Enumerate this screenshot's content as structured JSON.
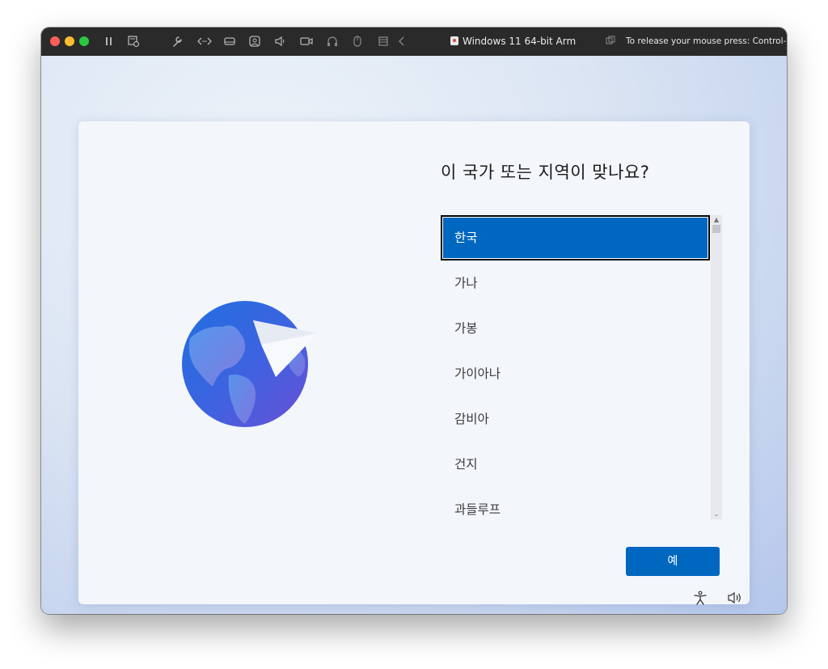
{
  "titlebar": {
    "title": "Windows 11 64-bit Arm",
    "release_hint": "To release your mouse press: Control-⌘",
    "icons": [
      "pause-icon",
      "snapshot-icon",
      "wrench-icon",
      "code-icon",
      "disk-icon",
      "user-icon",
      "speaker-icon",
      "camera-icon",
      "headphones-icon",
      "mouse-icon",
      "list-icon",
      "chevron-left-icon",
      "copy-icon"
    ]
  },
  "oobe": {
    "question": "이 국가 또는 지역이 맞나요?",
    "regions": [
      "한국",
      "가나",
      "가봉",
      "가이아나",
      "감비아",
      "건지",
      "과들루프"
    ],
    "selected_region": "한국",
    "yes_label": "예"
  },
  "taskbar": {
    "icons": [
      "accessibility-icon",
      "volume-icon"
    ]
  },
  "colors": {
    "accent": "#0067c0",
    "titlebar": "#2a2a2a",
    "close": "#ff5f57",
    "minimize": "#febc2e",
    "maximize": "#28c840"
  }
}
